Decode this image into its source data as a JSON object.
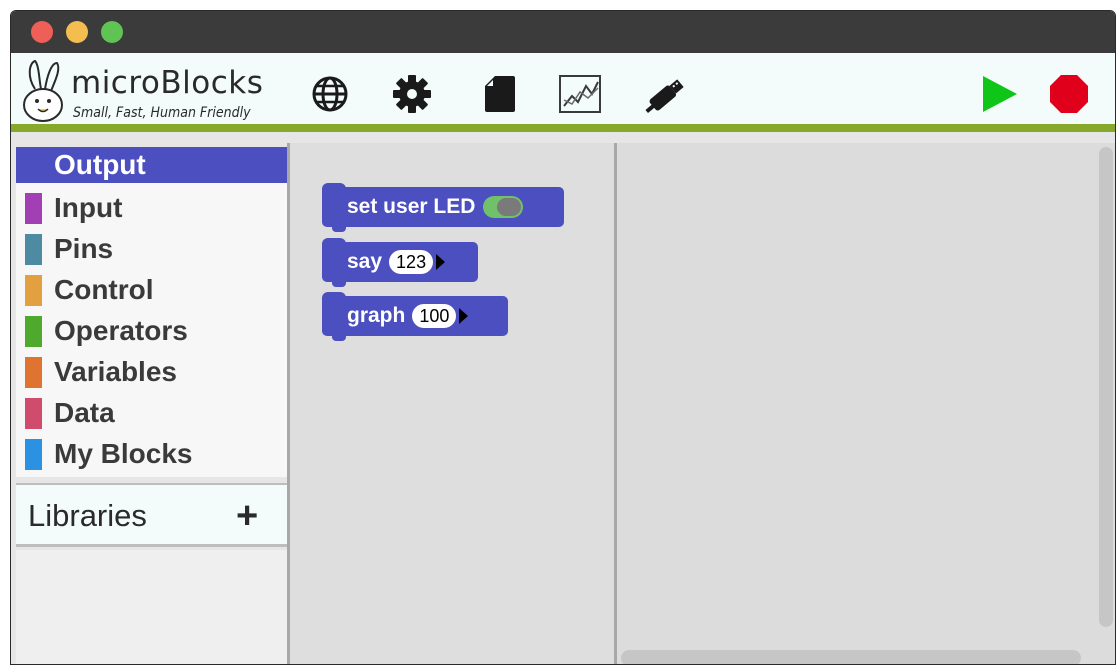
{
  "window": {
    "traffic_lights": [
      "close",
      "minimize",
      "zoom"
    ]
  },
  "app": {
    "name": "microBlocks",
    "tagline": "Small, Fast, Human Friendly"
  },
  "toolbar": {
    "icons": [
      "globe-icon",
      "gear-icon",
      "file-icon",
      "graph-icon",
      "usb-icon",
      "start-icon",
      "stop-icon"
    ],
    "colors": {
      "start": "#0fc517",
      "stop": "#e0001b",
      "accent_bar": "#86a92c"
    }
  },
  "categories": {
    "items": [
      {
        "label": "Output",
        "color": "#4b4fc0",
        "selected": true
      },
      {
        "label": "Input",
        "color": "#a33fb4"
      },
      {
        "label": "Pins",
        "color": "#4f8aa3"
      },
      {
        "label": "Control",
        "color": "#e3a040"
      },
      {
        "label": "Operators",
        "color": "#4fa92c"
      },
      {
        "label": "Variables",
        "color": "#de7430"
      },
      {
        "label": "Data",
        "color": "#d04c6c"
      },
      {
        "label": "My Blocks",
        "color": "#2b92e3"
      }
    ]
  },
  "libraries": {
    "label": "Libraries",
    "add_symbol": "+"
  },
  "palette": {
    "blocks": [
      {
        "label": "set user LED"
      },
      {
        "label": "say",
        "value": "123"
      },
      {
        "label": "graph",
        "value": "100"
      }
    ]
  }
}
